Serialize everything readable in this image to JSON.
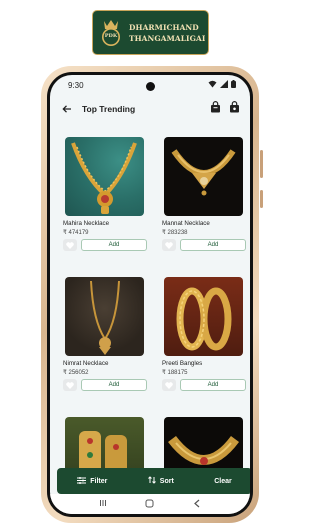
{
  "brand": {
    "name_line1": "DHARMICHAND",
    "name_line2": "THANGAMALIGAI",
    "monogram": "PDK",
    "color": "#1c4a30",
    "accent": "#c9a55a"
  },
  "status": {
    "time": "9:30"
  },
  "header": {
    "title": "Top Trending"
  },
  "products": [
    {
      "name": "Mahira Necklace",
      "price": "₹ 474179",
      "add_label": "Add"
    },
    {
      "name": "Mannat Necklace",
      "price": "₹ 283238",
      "add_label": "Add"
    },
    {
      "name": "Nimrat Necklace",
      "price": "₹ 256052",
      "add_label": "Add"
    },
    {
      "name": "Preeti Bangles",
      "price": "₹ 188175",
      "add_label": "Add"
    }
  ],
  "bottom_bar": {
    "filter": "Filter",
    "sort": "Sort",
    "clear": "Clear"
  },
  "colors": {
    "primary": "#1c4a30",
    "screen_bg": "#f2f6f7"
  }
}
